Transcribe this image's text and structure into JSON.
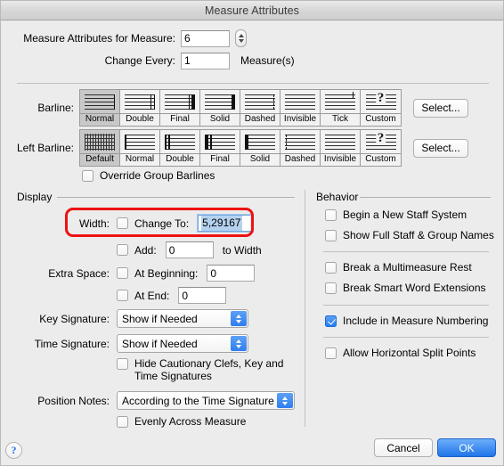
{
  "window": {
    "title": "Measure Attributes"
  },
  "top": {
    "measure_label": "Measure Attributes for Measure:",
    "measure_value": "6",
    "change_every_label": "Change Every:",
    "change_every_value": "1",
    "change_every_suffix": "Measure(s)"
  },
  "barline": {
    "label": "Barline:",
    "select_label": "Select...",
    "selected": "Normal",
    "options": [
      "Normal",
      "Double",
      "Final",
      "Solid",
      "Dashed",
      "Invisible",
      "Tick",
      "Custom"
    ]
  },
  "left_barline": {
    "label": "Left Barline:",
    "select_label": "Select...",
    "selected": "Default",
    "options": [
      "Default",
      "Normal",
      "Double",
      "Final",
      "Solid",
      "Dashed",
      "Invisible",
      "Custom"
    ]
  },
  "override_group_barlines": {
    "label": "Override Group Barlines",
    "checked": false
  },
  "display": {
    "group_label": "Display",
    "width_label": "Width:",
    "change_to_label": "Change To:",
    "change_to_checked": false,
    "change_to_value": "5,29167",
    "add_label": "Add:",
    "add_checked": false,
    "add_value": "0",
    "add_suffix": "to Width",
    "extra_space_label": "Extra Space:",
    "at_beginning_label": "At Beginning:",
    "at_beginning_checked": false,
    "at_beginning_value": "0",
    "at_end_label": "At End:",
    "at_end_checked": false,
    "at_end_value": "0",
    "key_signature_label": "Key Signature:",
    "key_signature_value": "Show if Needed",
    "time_signature_label": "Time Signature:",
    "time_signature_value": "Show if Needed",
    "hide_cautionary_line1": "Hide Cautionary Clefs, Key and",
    "hide_cautionary_line2": "Time Signatures",
    "hide_cautionary_checked": false,
    "position_notes_label": "Position Notes:",
    "position_notes_value": "According to the Time Signature",
    "evenly_label": "Evenly Across Measure",
    "evenly_checked": false
  },
  "behavior": {
    "group_label": "Behavior",
    "items": [
      {
        "label": "Begin a New Staff System",
        "checked": false
      },
      {
        "label": "Show Full Staff & Group Names",
        "checked": false
      },
      {
        "label": "Break a Multimeasure Rest",
        "checked": false
      },
      {
        "label": "Break Smart Word Extensions",
        "checked": false
      },
      {
        "label": "Include in Measure Numbering",
        "checked": true
      },
      {
        "label": "Allow Horizontal Split Points",
        "checked": false
      }
    ]
  },
  "footer": {
    "help_label": "?",
    "cancel_label": "Cancel",
    "ok_label": "OK"
  },
  "annotation": {
    "color": "#ee1111",
    "target": "width-change-to-row"
  },
  "colors": {
    "accent": "#2f7ef0",
    "selection": "#b4d2f0",
    "window_bg": "#ececec",
    "highlight": "#ee1111"
  }
}
